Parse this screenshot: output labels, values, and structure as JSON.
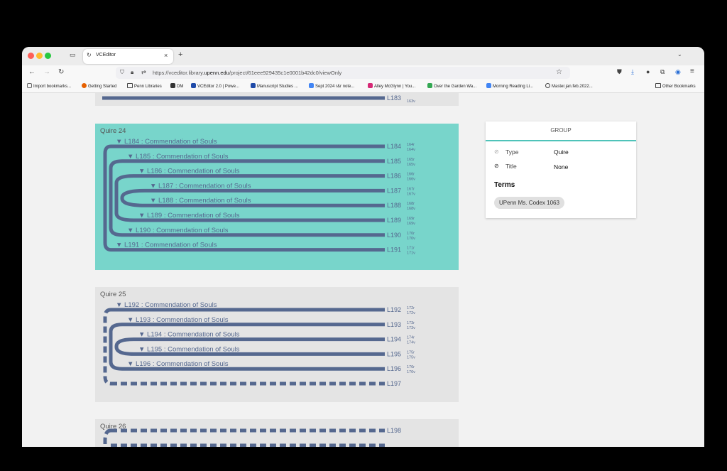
{
  "browser": {
    "tab_title": "VCEditor",
    "url_prefix": "https://vceditor.library.",
    "url_domain": "upenn.edu",
    "url_path": "/project/61eee929435c1e0001b42dc0/viewOnly",
    "bookmarks": [
      "Import bookmarks...",
      "Getting Started",
      "Penn Libraries",
      "DM",
      "VCEditor 2.0 | Powe...",
      "Manuscript Studies ...",
      "Sept 2024 r&r note...",
      "Alley McGlynn | You...",
      "Over the Garden Wa...",
      "Morning Reading Li...",
      "Master.jan.feb.2022..."
    ],
    "other_bookmarks": "Other Bookmarks"
  },
  "top_partial": {
    "leaf": "L183",
    "folio_r": "",
    "folio_v": "163v"
  },
  "quires": [
    {
      "label": "Quire 24",
      "bg": "#78d5cb",
      "leaves": [
        {
          "id": "L184",
          "text": "▼ L184 : Commendation of Souls",
          "r": "164r",
          "v": "164v"
        },
        {
          "id": "L185",
          "text": "▼ L185 : Commendation of Souls",
          "r": "165r",
          "v": "165v"
        },
        {
          "id": "L186",
          "text": "▼ L186 : Commendation of Souls",
          "r": "166r",
          "v": "166v"
        },
        {
          "id": "L187",
          "text": "▼ L187 : Commendation of Souls",
          "r": "167r",
          "v": "167v"
        },
        {
          "id": "L188",
          "text": "▼ L188 : Commendation of Souls",
          "r": "168r",
          "v": "168v"
        },
        {
          "id": "L189",
          "text": "▼ L189 : Commendation of Souls",
          "r": "169r",
          "v": "169v"
        },
        {
          "id": "L190",
          "text": "▼ L190 : Commendation of Souls",
          "r": "170r",
          "v": "170v"
        },
        {
          "id": "L191",
          "text": "▼ L191 : Commendation of Souls",
          "r": "171r",
          "v": "171v"
        }
      ]
    },
    {
      "label": "Quire 25",
      "bg": "#e4e4e4",
      "leaves": [
        {
          "id": "L192",
          "text": "▼ L192 : Commendation of Souls",
          "r": "172r",
          "v": "172v"
        },
        {
          "id": "L193",
          "text": "▼ L193 : Commendation of Souls",
          "r": "173r",
          "v": "173v"
        },
        {
          "id": "L194",
          "text": "▼ L194 : Commendation of Souls",
          "r": "174r",
          "v": "174v"
        },
        {
          "id": "L195",
          "text": "▼ L195 : Commendation of Souls",
          "r": "175r",
          "v": "175v"
        },
        {
          "id": "L196",
          "text": "▼ L196 : Commendation of Souls",
          "r": "176r",
          "v": "176v"
        },
        {
          "id": "L197",
          "text": "",
          "r": "",
          "v": ""
        }
      ]
    },
    {
      "label": "Quire 26",
      "bg": "#e4e4e4",
      "leaves": [
        {
          "id": "L198",
          "text": "",
          "r": "",
          "v": ""
        }
      ]
    }
  ],
  "panel": {
    "header": "GROUP",
    "type_label": "Type",
    "type_value": "Quire",
    "title_label": "Title",
    "title_value": "None",
    "terms_heading": "Terms",
    "term": "UPenn Ms. Codex 1063"
  },
  "colors": {
    "accent": "#4fc3b9",
    "leaf_line": "#55688f"
  }
}
